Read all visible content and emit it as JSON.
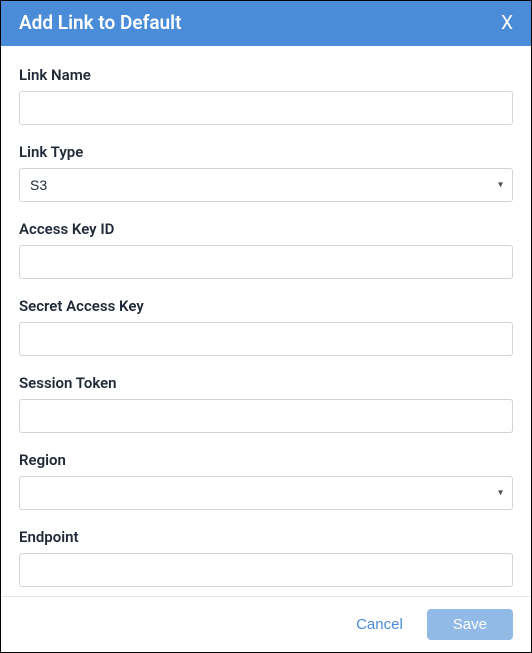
{
  "dialog": {
    "title": "Add Link to Default",
    "close_label": "X"
  },
  "fields": {
    "link_name": {
      "label": "Link Name",
      "value": ""
    },
    "link_type": {
      "label": "Link Type",
      "selected": "S3",
      "options": [
        "S3"
      ]
    },
    "access_key_id": {
      "label": "Access Key ID",
      "value": ""
    },
    "secret_access_key": {
      "label": "Secret Access Key",
      "value": ""
    },
    "session_token": {
      "label": "Session Token",
      "value": ""
    },
    "region": {
      "label": "Region",
      "selected": "",
      "options": [
        ""
      ]
    },
    "endpoint": {
      "label": "Endpoint",
      "value": ""
    }
  },
  "footer": {
    "cancel_label": "Cancel",
    "save_label": "Save"
  }
}
